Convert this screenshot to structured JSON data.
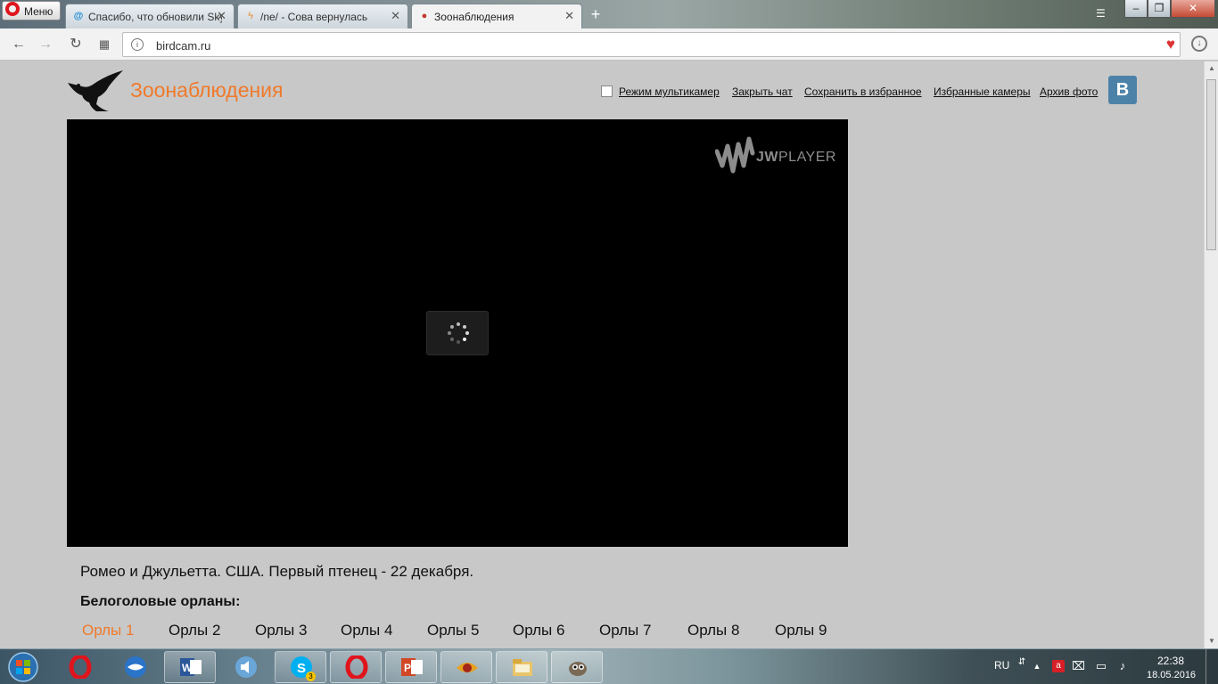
{
  "browser": {
    "menu_label": "Меню",
    "tabs": [
      {
        "title": "Спасибо, что обновили Skype",
        "icon": "at-icon"
      },
      {
        "title": "/ne/ - Сова вернулась",
        "icon": "bolt-icon"
      },
      {
        "title": "Зоонаблюдения",
        "icon": "bird-favicon"
      }
    ],
    "url": "birdcam.ru"
  },
  "site": {
    "logo_text": "Зоонаблюдения",
    "nav": {
      "multicam_label": "Режим мультикамер",
      "close_chat": "Закрыть чат",
      "save_favorites": "Сохранить в избранное",
      "favorite_cams": "Избранные камеры",
      "photo_archive": "Архив фото"
    },
    "vk_label": "В",
    "player": {
      "brand_bold": "JW",
      "brand_thin": "PLAYER"
    },
    "stream_caption": "Ромео и Джульетта. США. Первый птенец - 22 декабря.",
    "section_heading": "Белоголовые орланы:",
    "cameras": [
      "Орлы 1",
      "Орлы 2",
      "Орлы 3",
      "Орлы 4",
      "Орлы 5",
      "Орлы 6",
      "Орлы 7",
      "Орлы 8",
      "Орлы 9"
    ],
    "active_camera_index": 0,
    "accent_color": "#f07a2b"
  },
  "taskbar": {
    "apps": [
      "opera-icon",
      "thunderbird-icon",
      "word-icon",
      "speaker-app-icon",
      "skype-icon",
      "opera-icon",
      "powerpoint-icon",
      "xnview-icon",
      "explorer-icon",
      "gimp-icon"
    ],
    "skype_badge": "3",
    "language": "RU",
    "time": "22:38",
    "date": "18.05.2016"
  }
}
